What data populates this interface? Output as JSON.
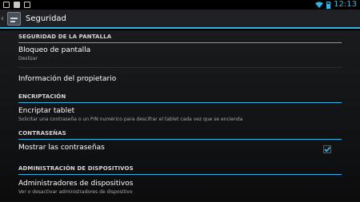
{
  "status_bar": {
    "left_icons": [
      "image-icon",
      "notification-icon",
      "check-icon"
    ],
    "time": "12:13",
    "accent": "#33b5e5"
  },
  "action_bar": {
    "title": "Seguridad",
    "icon": "settings-app-icon"
  },
  "sections": [
    {
      "header": "SEGURIDAD DE LA PANTALLA",
      "items": [
        {
          "title": "Bloqueo de pantalla",
          "subtitle": "Deslizar"
        },
        {
          "title": "Información del propietario"
        }
      ]
    },
    {
      "header": "ENCRIPTACIÓN",
      "items": [
        {
          "title": "Encriptar tablet",
          "subtitle": "Solicitar una contraseña o un PIN numérico para descifrar el tablet cada vez que se encienda"
        }
      ]
    },
    {
      "header": "CONTRASEÑAS",
      "items": [
        {
          "title": "Mostrar las contraseñas",
          "checked": true
        }
      ]
    },
    {
      "header": "ADMINISTRACIÓN DE DISPOSITIVOS",
      "items": [
        {
          "title": "Administradores de dispositivos",
          "subtitle": "Ver o desactivar administradores de dispositivo"
        }
      ]
    }
  ]
}
